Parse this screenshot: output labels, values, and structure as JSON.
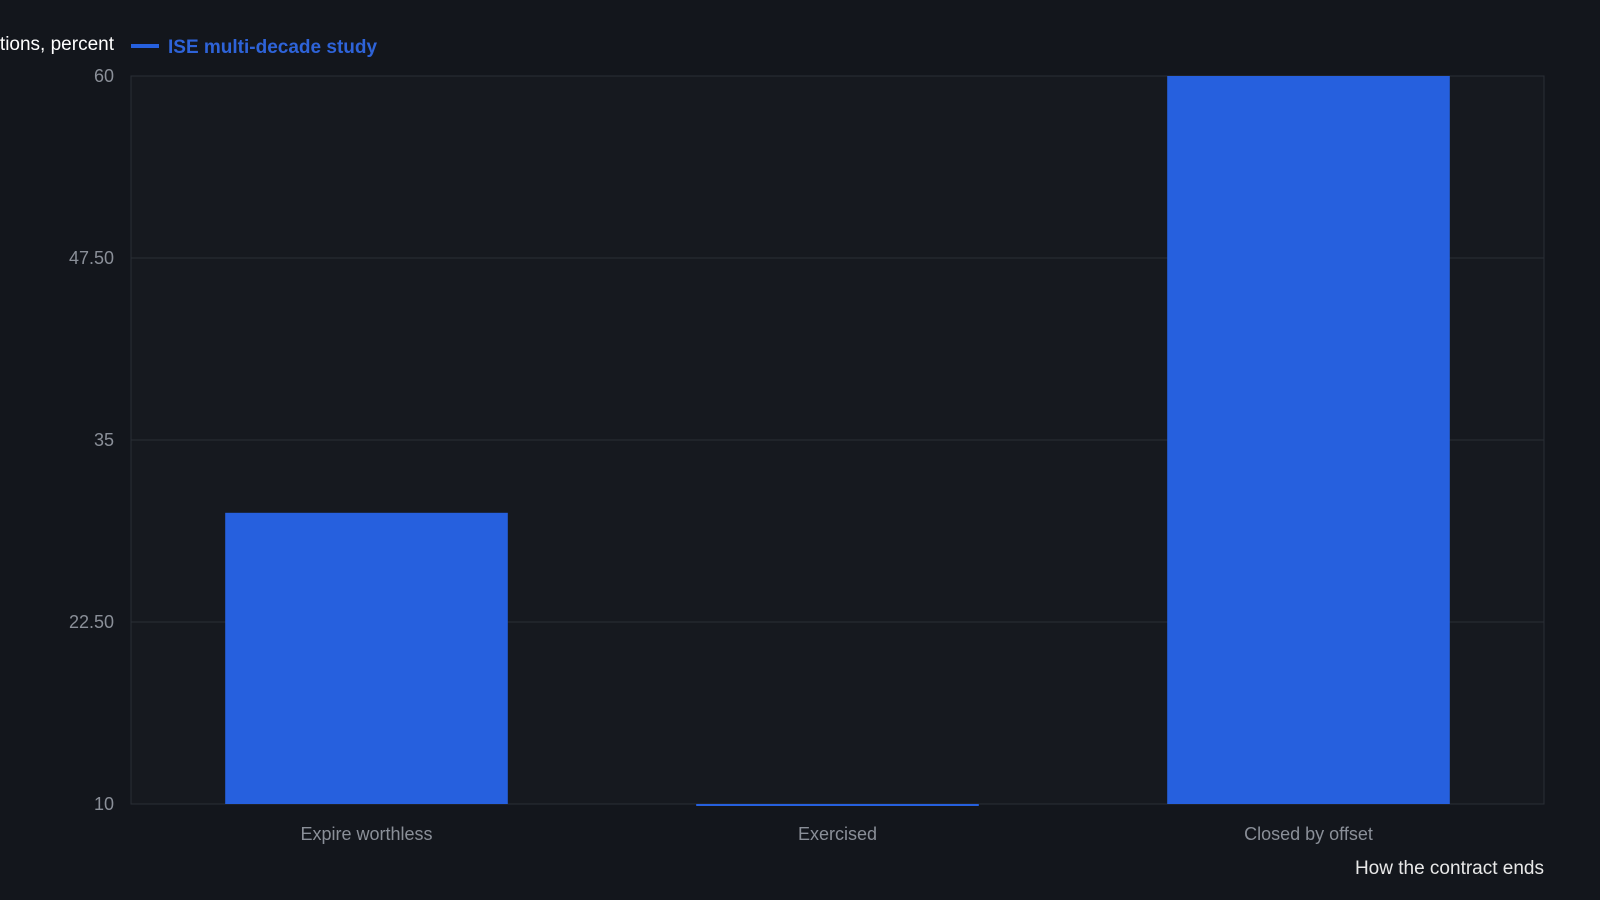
{
  "chart_data": {
    "type": "bar",
    "ylabel": "tions, percent",
    "xlabel": "How the contract ends",
    "categories": [
      "Expire worthless",
      "Exercised",
      "Closed by offset"
    ],
    "series": [
      {
        "name": "ISE multi-decade study",
        "values": [
          30,
          10,
          60
        ]
      }
    ],
    "ylim": [
      10,
      60
    ],
    "yticks": [
      "10",
      "22.50",
      "35",
      "47.50",
      "60"
    ],
    "grid": true,
    "legend_position": "top-left"
  },
  "colors": {
    "background": "#13161c",
    "plot_background": "#16191f",
    "bar": "#2660de",
    "grid": "#2a2e36",
    "legend_text": "#2e63d8"
  }
}
